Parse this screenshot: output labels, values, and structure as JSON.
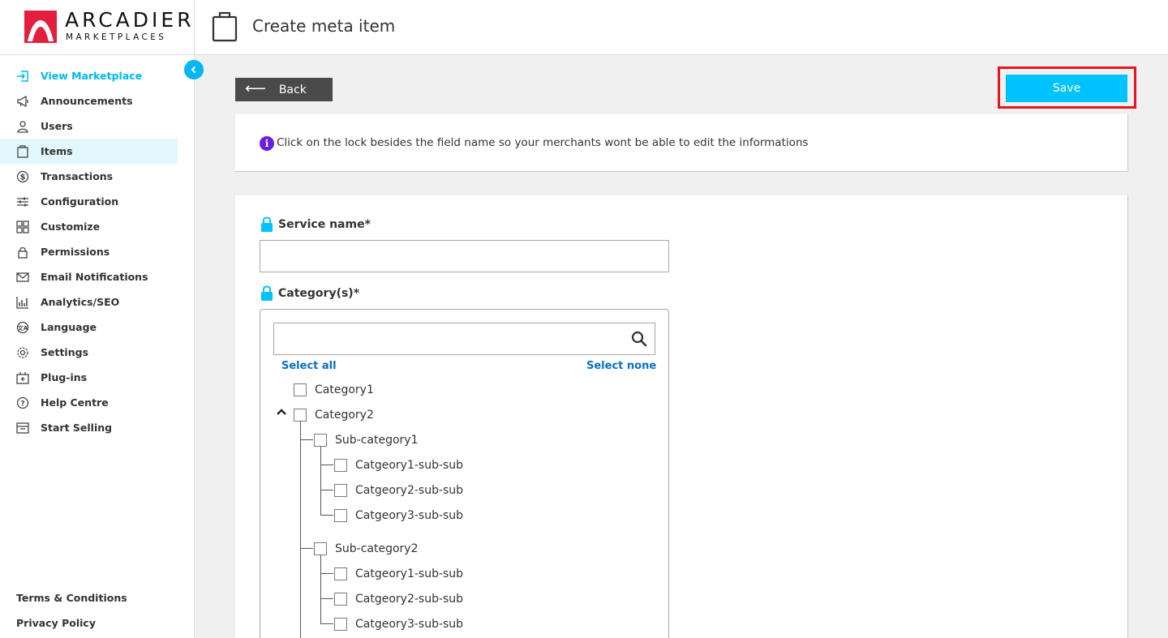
{
  "brand": {
    "name": "ARCADIER",
    "tagline": "MARKETPLACES"
  },
  "header": {
    "title": "Create meta item"
  },
  "sidebar": {
    "items": [
      {
        "label": "View Marketplace",
        "icon": "enter-icon"
      },
      {
        "label": "Announcements",
        "icon": "megaphone-icon"
      },
      {
        "label": "Users",
        "icon": "user-icon"
      },
      {
        "label": "Items",
        "icon": "clipboard-icon"
      },
      {
        "label": "Transactions",
        "icon": "dollar-icon"
      },
      {
        "label": "Configuration",
        "icon": "sliders-icon"
      },
      {
        "label": "Customize",
        "icon": "grid-icon"
      },
      {
        "label": "Permissions",
        "icon": "lock-icon"
      },
      {
        "label": "Email Notifications",
        "icon": "mail-icon"
      },
      {
        "label": "Analytics/SEO",
        "icon": "bar-chart-icon"
      },
      {
        "label": "Language",
        "icon": "translate-icon"
      },
      {
        "label": "Settings",
        "icon": "gear-icon"
      },
      {
        "label": "Plug-ins",
        "icon": "plugin-icon"
      },
      {
        "label": "Help Centre",
        "icon": "help-icon"
      },
      {
        "label": "Start Selling",
        "icon": "storefront-icon"
      }
    ],
    "footer": {
      "terms": "Terms & Conditions",
      "privacy": "Privacy Policy"
    }
  },
  "actions": {
    "back_label": "Back",
    "save_label": "Save"
  },
  "info": {
    "icon_glyph": "i",
    "text": "Click on the lock besides the field name so your merchants wont be able to edit the informations"
  },
  "form": {
    "service_name_label": "Service name*",
    "service_name_value": "",
    "category_label": "Category(s)*",
    "category_search_value": "",
    "select_all": "Select all",
    "select_none": "Select none",
    "categories": {
      "c1": "Category1",
      "c2": "Category2",
      "sub1": "Sub-category1",
      "sub1_a": "Catgeory1-sub-sub",
      "sub1_b": "Catgeory2-sub-sub",
      "sub1_c": "Catgeory3-sub-sub",
      "sub2": "Sub-category2",
      "sub2_a": "Catgeory1-sub-sub",
      "sub2_b": "Catgeory2-sub-sub",
      "sub2_c": "Catgeory3-sub-sub"
    }
  },
  "colors": {
    "accent": "#00c2ff",
    "save_highlight": "#e8141c",
    "info_icon": "#6a1fe0",
    "link": "#0a6fc2",
    "logo_red": "#e41e3f"
  }
}
